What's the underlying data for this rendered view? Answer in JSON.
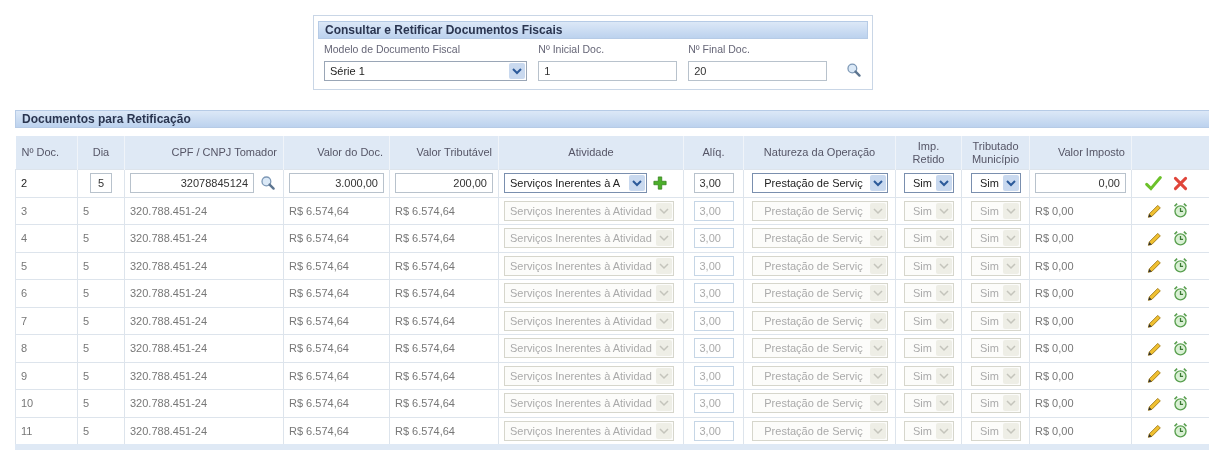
{
  "query_panel": {
    "title": "Consultar e Retificar Documentos Fiscais",
    "fields": [
      {
        "kind": "select",
        "label": "Modelo de Documento Fiscal",
        "value": "Série 1"
      },
      {
        "kind": "text",
        "label": "Nº Inicial Doc.",
        "value": "1"
      },
      {
        "kind": "text",
        "label": "Nº Final Doc.",
        "value": "20"
      }
    ]
  },
  "table": {
    "title": "Documentos para Retificação",
    "columns": [
      "Nº Doc.",
      "Dia",
      "CPF / CNPJ Tomador",
      "Valor do Doc.",
      "Valor Tributável",
      "Atividade",
      "Alíq.",
      "Natureza da Operação",
      "Imp. Retido",
      "Tributado Município",
      "Valor Imposto"
    ],
    "rows": [
      {
        "editing": true,
        "doc": "2",
        "dia": "5",
        "cpf": "32078845124",
        "valor_doc": "3.000,00",
        "valor_trib": "200,00",
        "atividade": "Serviços Inerentes à A",
        "aliquota": "3,00",
        "natureza": "Prestação de Serviç",
        "imp_retido": "Sim",
        "tributado": "Sim",
        "valor_imposto": "0,00"
      },
      {
        "editing": false,
        "doc": "3",
        "dia": "5",
        "cpf": "320.788.451-24",
        "valor_doc": "R$ 6.574,64",
        "valor_trib": "R$ 6.574,64",
        "atividade": "Serviços Inerentes à Atividad",
        "aliquota": "3,00",
        "natureza": "Prestação de Serviç",
        "imp_retido": "Sim",
        "tributado": "Sim",
        "valor_imposto": "R$ 0,00"
      },
      {
        "editing": false,
        "doc": "4",
        "dia": "5",
        "cpf": "320.788.451-24",
        "valor_doc": "R$ 6.574,64",
        "valor_trib": "R$ 6.574,64",
        "atividade": "Serviços Inerentes à Atividad",
        "aliquota": "3,00",
        "natureza": "Prestação de Serviç",
        "imp_retido": "Sim",
        "tributado": "Sim",
        "valor_imposto": "R$ 0,00"
      },
      {
        "editing": false,
        "doc": "5",
        "dia": "5",
        "cpf": "320.788.451-24",
        "valor_doc": "R$ 6.574,64",
        "valor_trib": "R$ 6.574,64",
        "atividade": "Serviços Inerentes à Atividad",
        "aliquota": "3,00",
        "natureza": "Prestação de Serviç",
        "imp_retido": "Sim",
        "tributado": "Sim",
        "valor_imposto": "R$ 0,00"
      },
      {
        "editing": false,
        "doc": "6",
        "dia": "5",
        "cpf": "320.788.451-24",
        "valor_doc": "R$ 6.574,64",
        "valor_trib": "R$ 6.574,64",
        "atividade": "Serviços Inerentes à Atividad",
        "aliquota": "3,00",
        "natureza": "Prestação de Serviç",
        "imp_retido": "Sim",
        "tributado": "Sim",
        "valor_imposto": "R$ 0,00"
      },
      {
        "editing": false,
        "doc": "7",
        "dia": "5",
        "cpf": "320.788.451-24",
        "valor_doc": "R$ 6.574,64",
        "valor_trib": "R$ 6.574,64",
        "atividade": "Serviços Inerentes à Atividad",
        "aliquota": "3,00",
        "natureza": "Prestação de Serviç",
        "imp_retido": "Sim",
        "tributado": "Sim",
        "valor_imposto": "R$ 0,00"
      },
      {
        "editing": false,
        "doc": "8",
        "dia": "5",
        "cpf": "320.788.451-24",
        "valor_doc": "R$ 6.574,64",
        "valor_trib": "R$ 6.574,64",
        "atividade": "Serviços Inerentes à Atividad",
        "aliquota": "3,00",
        "natureza": "Prestação de Serviç",
        "imp_retido": "Sim",
        "tributado": "Sim",
        "valor_imposto": "R$ 0,00"
      },
      {
        "editing": false,
        "doc": "9",
        "dia": "5",
        "cpf": "320.788.451-24",
        "valor_doc": "R$ 6.574,64",
        "valor_trib": "R$ 6.574,64",
        "atividade": "Serviços Inerentes à Atividad",
        "aliquota": "3,00",
        "natureza": "Prestação de Serviç",
        "imp_retido": "Sim",
        "tributado": "Sim",
        "valor_imposto": "R$ 0,00"
      },
      {
        "editing": false,
        "doc": "10",
        "dia": "5",
        "cpf": "320.788.451-24",
        "valor_doc": "R$ 6.574,64",
        "valor_trib": "R$ 6.574,64",
        "atividade": "Serviços Inerentes à Atividad",
        "aliquota": "3,00",
        "natureza": "Prestação de Serviç",
        "imp_retido": "Sim",
        "tributado": "Sim",
        "valor_imposto": "R$ 0,00"
      },
      {
        "editing": false,
        "doc": "11",
        "dia": "5",
        "cpf": "320.788.451-24",
        "valor_doc": "R$ 6.574,64",
        "valor_trib": "R$ 6.574,64",
        "atividade": "Serviços Inerentes à Atividad",
        "aliquota": "3,00",
        "natureza": "Prestação de Serviç",
        "imp_retido": "Sim",
        "tributado": "Sim",
        "valor_imposto": "R$ 0,00"
      }
    ]
  }
}
